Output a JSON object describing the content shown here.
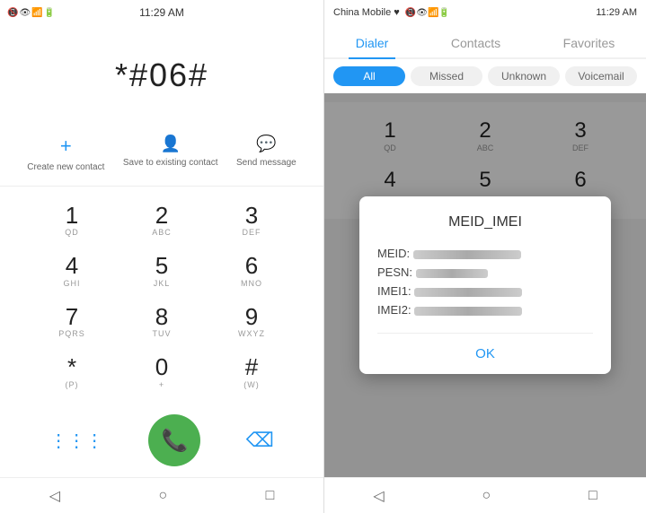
{
  "left": {
    "statusBar": {
      "icons": "📵 👁 📶 🔋",
      "time": "11:29 AM"
    },
    "display": "*#06#",
    "actions": [
      {
        "label": "Create new contact",
        "icon": "+"
      },
      {
        "label": "Save to existing contact",
        "icon": "👤"
      },
      {
        "label": "Send message",
        "icon": "💬"
      }
    ],
    "keys": [
      {
        "num": "1",
        "sub": "QD"
      },
      {
        "num": "2",
        "sub": "ABC"
      },
      {
        "num": "3",
        "sub": "DEF"
      },
      {
        "num": "4",
        "sub": "GHI"
      },
      {
        "num": "5",
        "sub": "JKL"
      },
      {
        "num": "6",
        "sub": "MNO"
      },
      {
        "num": "7",
        "sub": "PQRS"
      },
      {
        "num": "8",
        "sub": "TUV"
      },
      {
        "num": "9",
        "sub": "WXYZ"
      },
      {
        "num": "*",
        "sub": "(P)"
      },
      {
        "num": "0",
        "sub": "+"
      },
      {
        "num": "#",
        "sub": "(W)"
      }
    ],
    "nav": [
      "◁",
      "○",
      "□"
    ]
  },
  "right": {
    "statusBar": {
      "carrier": "China Mobile ♥",
      "icons": "📵 👁 📶 🔋",
      "time": "11:29 AM"
    },
    "tabs": [
      {
        "label": "Dialer",
        "active": true
      },
      {
        "label": "Contacts",
        "active": false
      },
      {
        "label": "Favorites",
        "active": false
      }
    ],
    "filters": [
      {
        "label": "All",
        "active": true
      },
      {
        "label": "Missed",
        "active": false
      },
      {
        "label": "Unknown",
        "active": false
      },
      {
        "label": "Voicemail",
        "active": false
      }
    ],
    "keys": [
      {
        "num": "1",
        "sub": "QD"
      },
      {
        "num": "2",
        "sub": "ABC"
      },
      {
        "num": "3",
        "sub": "DEF"
      },
      {
        "num": "4",
        "sub": ""
      },
      {
        "num": "5",
        "sub": ""
      },
      {
        "num": "6",
        "sub": ""
      }
    ],
    "modal": {
      "title": "MEID_IMEI",
      "rows": [
        {
          "label": "MEID:",
          "value": "A████████████"
        },
        {
          "label": "PESN:",
          "value": "8█████████"
        },
        {
          "label": "IMEI1:",
          "value": "8████████████"
        },
        {
          "label": "IMEI2:",
          "value": "8████████████"
        }
      ],
      "okLabel": "OK"
    },
    "nav": [
      "◁",
      "○",
      "□"
    ]
  }
}
